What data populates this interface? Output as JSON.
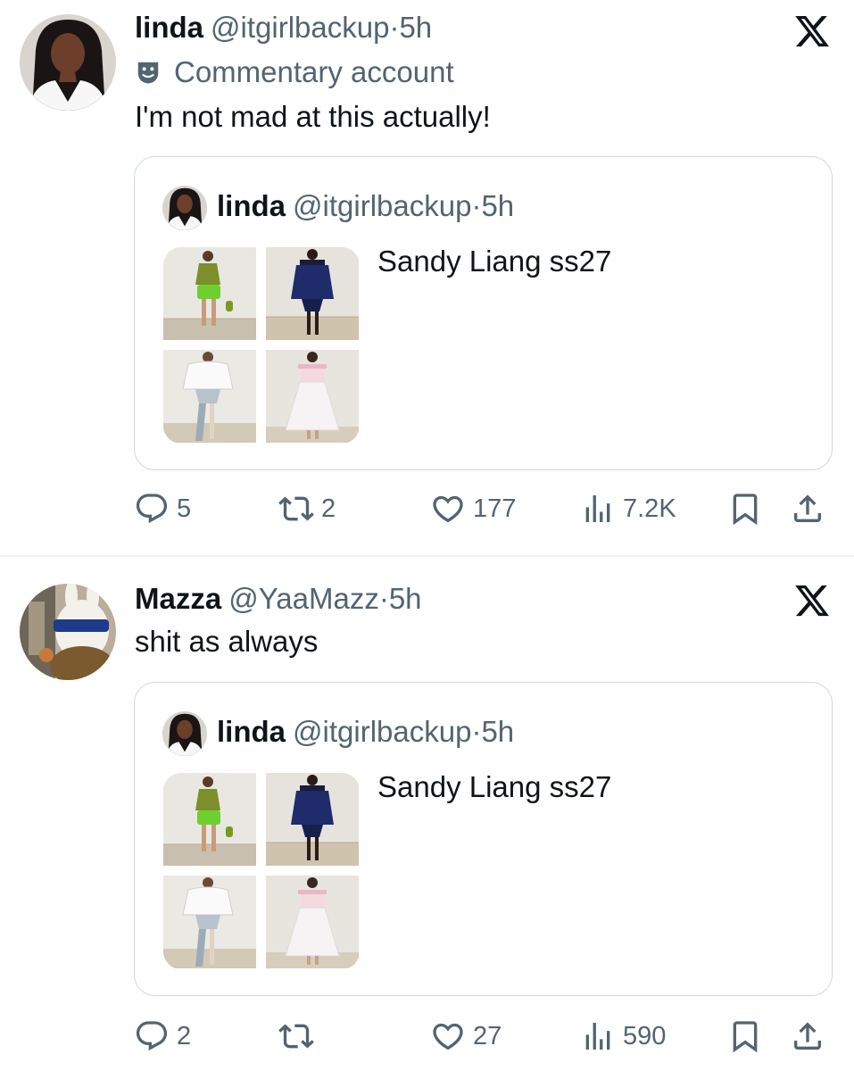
{
  "tweets": [
    {
      "author": {
        "name": "linda",
        "handle": "@itgirlbackup",
        "dot": "·",
        "time": "5h"
      },
      "badge": {
        "icon": "theater-masks-icon",
        "label": "Commentary account"
      },
      "text": "I'm not mad at this actually!",
      "quote": {
        "author": {
          "name": "linda",
          "handle": "@itgirlbackup",
          "dot": "·",
          "time": "5h"
        },
        "text": "Sandy Liang ss27",
        "images": [
          "runway-look-green",
          "runway-look-navy",
          "runway-look-white-jacket",
          "runway-look-pink-tulle"
        ]
      },
      "stats": {
        "replies": "5",
        "reposts": "2",
        "likes": "177",
        "views": "7.2K"
      }
    },
    {
      "author": {
        "name": "Mazza",
        "handle": "@YaaMazz",
        "dot": "·",
        "time": "5h"
      },
      "text": "shit as always",
      "quote": {
        "author": {
          "name": "linda",
          "handle": "@itgirlbackup",
          "dot": "·",
          "time": "5h"
        },
        "text": "Sandy Liang ss27",
        "images": [
          "runway-look-green",
          "runway-look-navy",
          "runway-look-white-jacket",
          "runway-look-pink-tulle"
        ]
      },
      "stats": {
        "replies": "2",
        "reposts": "",
        "likes": "27",
        "views": "590"
      }
    }
  ],
  "colors": {
    "text": "#0f1419",
    "secondary": "#536471",
    "border": "#cfd9de"
  }
}
